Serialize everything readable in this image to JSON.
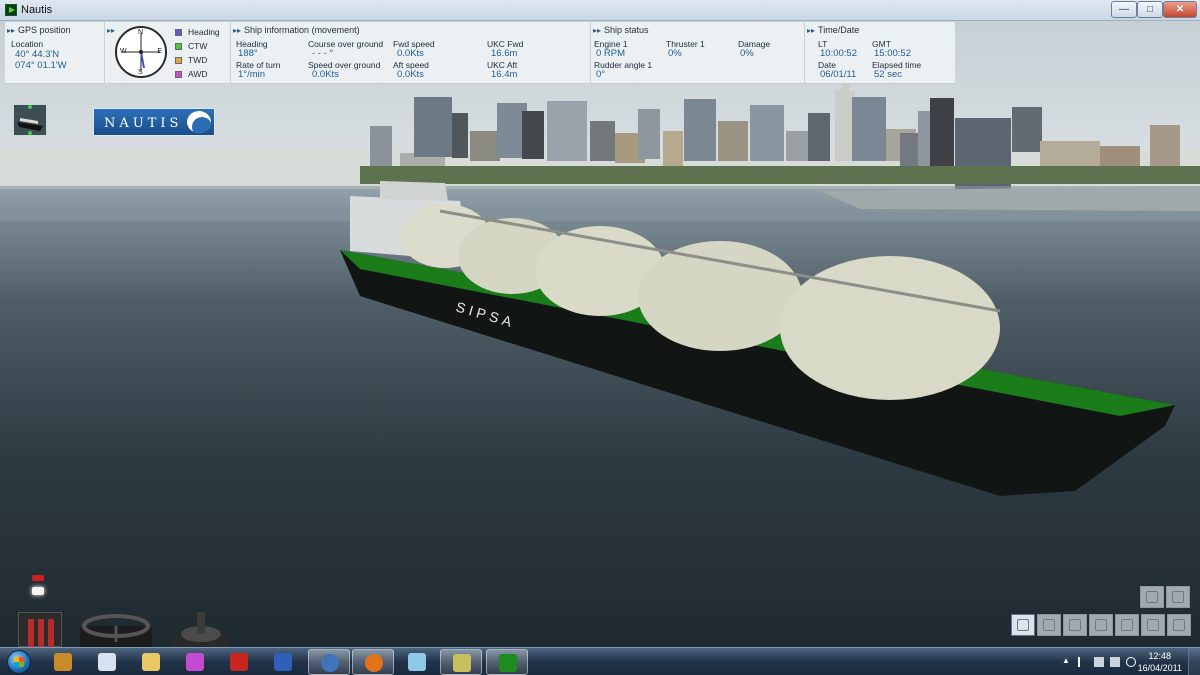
{
  "window": {
    "title": "Nautis",
    "min": "—",
    "max": "□",
    "close": "✕"
  },
  "hud": {
    "gps": {
      "header": "GPS position",
      "location_label": "Location",
      "lat": "40° 44.3'N",
      "lon": "074° 01.1'W"
    },
    "compass": {
      "n": "N",
      "e": "E",
      "s": "S",
      "w": "W"
    },
    "legend": [
      {
        "label": "Heading",
        "color": "#5a5fc8"
      },
      {
        "label": "CTW",
        "color": "#56c23a"
      },
      {
        "label": "TWD",
        "color": "#e2a640"
      },
      {
        "label": "AWD",
        "color": "#c84fc8"
      }
    ],
    "ship_info": {
      "header": "Ship information (movement)",
      "heading_label": "Heading",
      "heading": "188°",
      "rot_label": "Rate of turn",
      "rot": "1°/min",
      "cog_label": "Course over ground",
      "cog": "- - - °",
      "sog_label": "Speed over ground",
      "sog": "0.0Kts",
      "fwd_label": "Fwd speed",
      "fwd": "0.0Kts",
      "aft_label": "Aft speed",
      "aft": "0.0Kts",
      "ukc_fwd_label": "UKC Fwd",
      "ukc_fwd": "16.6m",
      "ukc_aft_label": "UKC Aft",
      "ukc_aft": "16.4m"
    },
    "ship_status": {
      "header": "Ship status",
      "engine_label": "Engine 1",
      "engine": "0 RPM",
      "thruster_label": "Thruster 1",
      "thruster": "0%",
      "damage_label": "Damage",
      "damage": "0%",
      "rudder_label": "Rudder angle 1",
      "rudder": "0°"
    },
    "time": {
      "header": "Time/Date",
      "lt_label": "LT",
      "lt": "10:00:52",
      "gmt_label": "GMT",
      "gmt": "15:00:52",
      "date_label": "Date",
      "date": "06/01/11",
      "elapsed_label": "Elapsed time",
      "elapsed": "52 sec"
    }
  },
  "logo": {
    "text": "NAUTIS"
  },
  "ship": {
    "name": "SIPSA"
  },
  "taskbar": {
    "apps": [
      {
        "name": "game",
        "color": "#c98a2a"
      },
      {
        "name": "calculator",
        "color": "#d8e2ee"
      },
      {
        "name": "explorer",
        "color": "#e8c866"
      },
      {
        "name": "paint",
        "color": "#c24bd1"
      },
      {
        "name": "acrobat",
        "color": "#c8261f"
      },
      {
        "name": "word",
        "color": "#2f5fb8"
      },
      {
        "name": "thunderbird",
        "color": "#3f74b8"
      },
      {
        "name": "firefox",
        "color": "#e2721c"
      },
      {
        "name": "notepad",
        "color": "#8fc9e8"
      },
      {
        "name": "folder-sync",
        "color": "#c7c05a"
      },
      {
        "name": "nautis",
        "color": "#1f8c1f"
      }
    ],
    "time": "12:48",
    "date": "16/04/2011"
  }
}
